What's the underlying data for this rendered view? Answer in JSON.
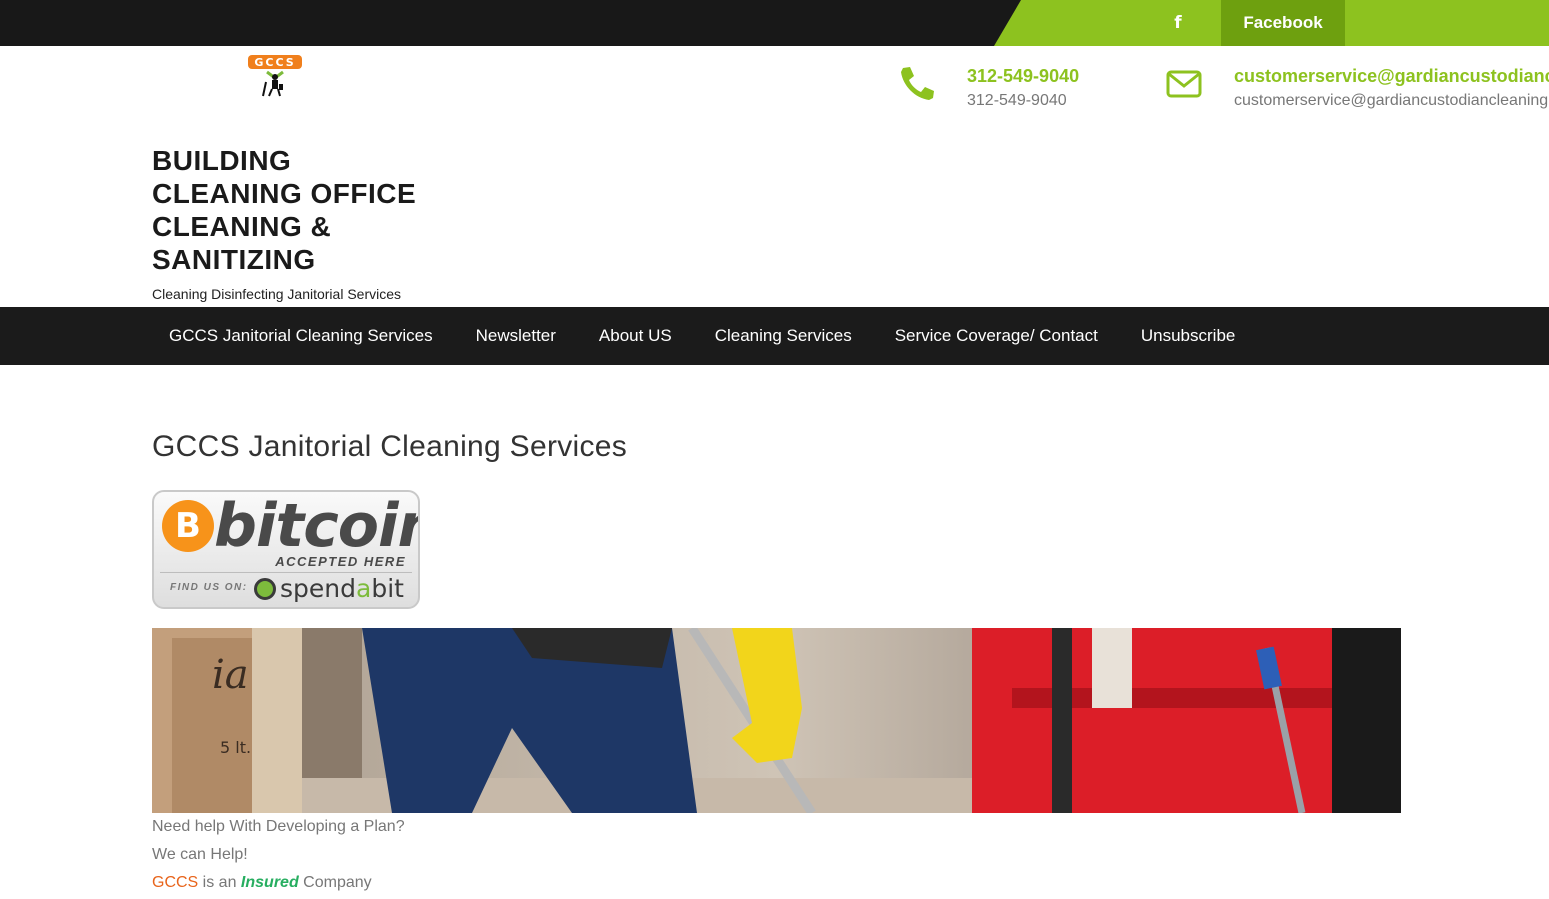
{
  "topbar": {
    "facebook_icon": "f",
    "facebook_label": "Facebook"
  },
  "header": {
    "logo_text": "GCCS",
    "phone": {
      "icon": "phone-icon",
      "title": "312-549-9040",
      "subtitle": "312-549-9040"
    },
    "email": {
      "icon": "envelope-icon",
      "title": "customerservice@gardiancustodiancleaning.com",
      "subtitle": "customerservice@gardiancustodiancleaning.com"
    }
  },
  "site": {
    "title": "BUILDING CLEANING OFFICE CLEANING & SANITIZING",
    "tagline": "Cleaning Disinfecting Janitorial Services"
  },
  "nav": {
    "items": [
      {
        "label": "GCCS Janitorial Cleaning Services"
      },
      {
        "label": "Newsletter"
      },
      {
        "label": "About US"
      },
      {
        "label": "Cleaning Services"
      },
      {
        "label": "Service Coverage/ Contact"
      },
      {
        "label": "Unsubscribe"
      }
    ]
  },
  "main": {
    "heading": "GCCS Janitorial Cleaning Services",
    "bitcoin_badge": {
      "symbol": "B",
      "word": "bitcoin",
      "accepted": "ACCEPTED HERE",
      "find_us": "FIND US ON:",
      "spendabit_pre": "spend",
      "spendabit_a": "a",
      "spendabit_post": "bit"
    },
    "line1": "Need help With Developing a Plan?",
    "line2": "We can Help!",
    "line3_brand": "GCCS",
    "line3_mid": " is an ",
    "line3_insured": "Insured",
    "line3_end": " Company"
  },
  "colors": {
    "accent": "#8dc21f",
    "dark": "#1b1b1b",
    "orange": "#e8641b",
    "insured_green": "#27ae60"
  }
}
